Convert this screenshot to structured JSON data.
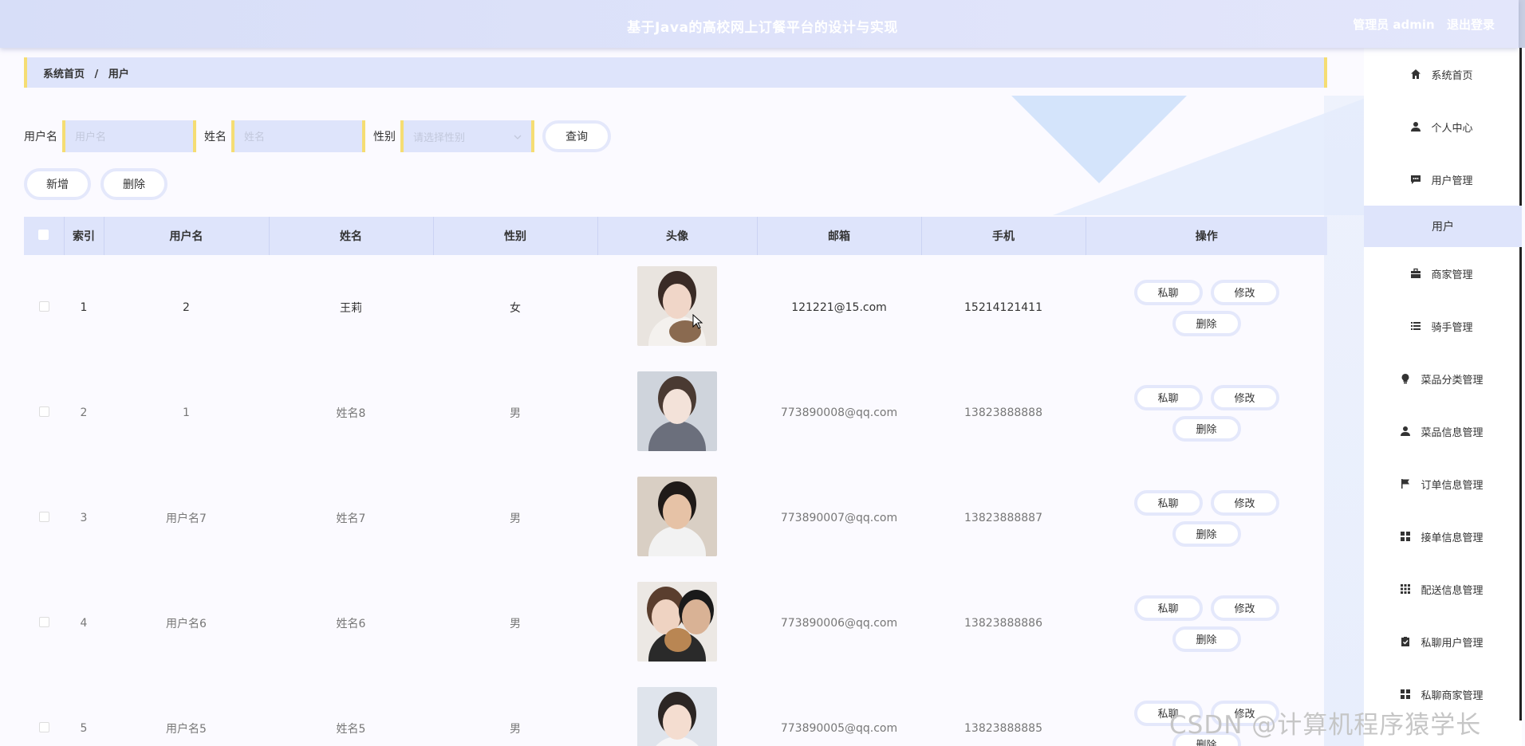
{
  "header": {
    "title": "基于Java的高校网上订餐平台的设计与实现",
    "role_user": "管理员 admin",
    "logout": "退出登录"
  },
  "breadcrumb": {
    "home": "系统首页",
    "separator": "/",
    "current": "用户"
  },
  "search": {
    "username_label": "用户名",
    "username_placeholder": "用户名",
    "name_label": "姓名",
    "name_placeholder": "姓名",
    "gender_label": "性别",
    "gender_placeholder": "请选择性别",
    "query_button": "查询"
  },
  "actions": {
    "add": "新增",
    "delete": "删除"
  },
  "table": {
    "headers": [
      "索引",
      "用户名",
      "姓名",
      "性别",
      "头像",
      "邮箱",
      "手机",
      "操作"
    ],
    "rows": [
      {
        "index": "1",
        "username": "2",
        "name": "王莉",
        "gender": "女",
        "email": "121221@15.com",
        "phone": "15214121411"
      },
      {
        "index": "2",
        "username": "1",
        "name": "姓名8",
        "gender": "男",
        "email": "773890008@qq.com",
        "phone": "13823888888"
      },
      {
        "index": "3",
        "username": "用户名7",
        "name": "姓名7",
        "gender": "男",
        "email": "773890007@qq.com",
        "phone": "13823888887"
      },
      {
        "index": "4",
        "username": "用户名6",
        "name": "姓名6",
        "gender": "男",
        "email": "773890006@qq.com",
        "phone": "13823888886"
      },
      {
        "index": "5",
        "username": "用户名5",
        "name": "姓名5",
        "gender": "男",
        "email": "773890005@qq.com",
        "phone": "13823888885"
      }
    ],
    "op_chat": "私聊",
    "op_edit": "修改",
    "op_delete": "删除"
  },
  "sidebar": {
    "items": [
      {
        "label": "系统首页",
        "icon": "home-icon"
      },
      {
        "label": "个人中心",
        "icon": "person-icon"
      },
      {
        "label": "用户管理",
        "icon": "chat-icon"
      },
      {
        "label": "商家管理",
        "icon": "briefcase-icon"
      },
      {
        "label": "骑手管理",
        "icon": "list-icon"
      },
      {
        "label": "菜品分类管理",
        "icon": "bulb-icon"
      },
      {
        "label": "菜品信息管理",
        "icon": "person-icon"
      },
      {
        "label": "订单信息管理",
        "icon": "flag-icon"
      },
      {
        "label": "接单信息管理",
        "icon": "grid-icon"
      },
      {
        "label": "配送信息管理",
        "icon": "apps-icon"
      },
      {
        "label": "私聊用户管理",
        "icon": "clipboard-check-icon"
      },
      {
        "label": "私聊商家管理",
        "icon": "grid-icon"
      }
    ],
    "sub_active": "用户"
  },
  "watermark": "CSDN @计算机程序猿学长",
  "colors": {
    "header_bg": "#d7def8",
    "accent_panel": "#dee4fb",
    "accent_border": "#f5dd73"
  }
}
